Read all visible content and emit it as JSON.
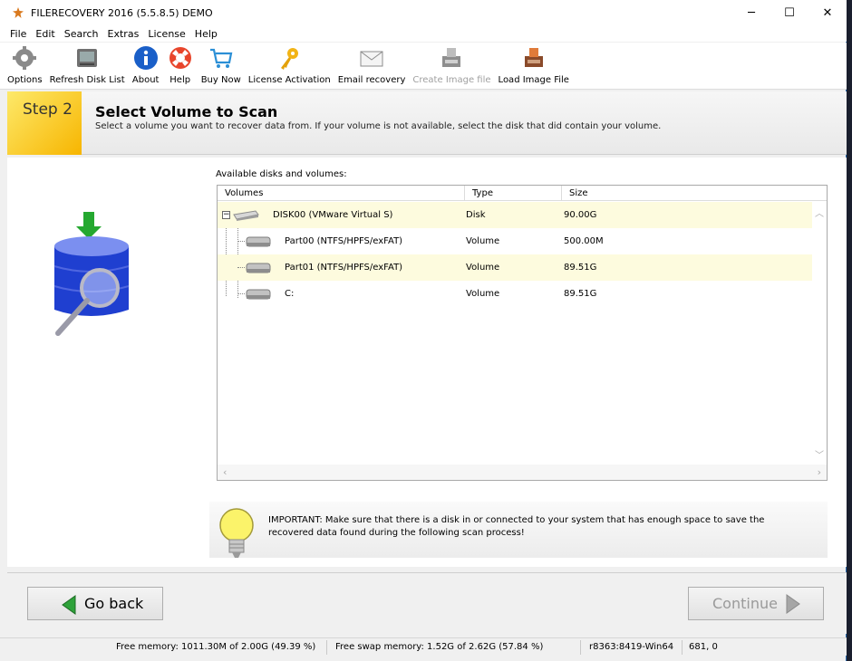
{
  "window": {
    "title": "FILERECOVERY 2016 (5.5.8.5) DEMO",
    "controls": {
      "minimize": "─",
      "maximize": "☐",
      "close": "✕"
    }
  },
  "menu": [
    "File",
    "Edit",
    "Search",
    "Extras",
    "License",
    "Help"
  ],
  "toolbar": {
    "items": [
      {
        "label": "Options",
        "icon": "gear-icon",
        "enabled": true
      },
      {
        "label": "Refresh Disk List",
        "icon": "disk-refresh-icon",
        "enabled": true
      },
      {
        "label": "About",
        "icon": "info-icon",
        "enabled": true
      },
      {
        "label": "Help",
        "icon": "lifebuoy-icon",
        "enabled": true
      },
      {
        "label": "Buy Now",
        "icon": "cart-icon",
        "enabled": true
      },
      {
        "label": "License Activation",
        "icon": "key-icon",
        "enabled": true
      },
      {
        "label": "Email recovery",
        "icon": "envelope-icon",
        "enabled": true
      },
      {
        "label": "Create Image file",
        "icon": "create-image-icon",
        "enabled": false
      },
      {
        "label": "Load Image File",
        "icon": "load-image-icon",
        "enabled": true
      }
    ]
  },
  "step": {
    "badge": "Step 2",
    "title": "Select Volume to Scan",
    "description": "Select a volume you want to recover data from. If your volume is not available, select the disk that did contain your volume."
  },
  "volumes": {
    "label": "Available disks and volumes:",
    "columns": [
      "Volumes",
      "Type",
      "Size"
    ],
    "rows": [
      {
        "name": "DISK00 (VMware Virtual S)",
        "type": "Disk",
        "size": "90.00G",
        "level": 0
      },
      {
        "name": "Part00 (NTFS/HPFS/exFAT)",
        "type": "Volume",
        "size": "500.00M",
        "level": 1
      },
      {
        "name": "Part01 (NTFS/HPFS/exFAT)",
        "type": "Volume",
        "size": "89.51G",
        "level": 1
      },
      {
        "name": "C:",
        "type": "Volume",
        "size": "89.51G",
        "level": 1
      }
    ]
  },
  "important": {
    "text": "IMPORTANT: Make sure that there is a disk in or connected to your system that has enough space to save the recovered data found during the following scan process!"
  },
  "buttons": {
    "back": "Go back",
    "continue": "Continue"
  },
  "status": {
    "free_memory": "Free memory: 1011.30M of 2.00G (49.39 %)",
    "free_swap": "Free swap memory: 1.52G of 2.62G (57.84 %)",
    "build": "r8363:8419-Win64",
    "coords": "681, 0"
  }
}
